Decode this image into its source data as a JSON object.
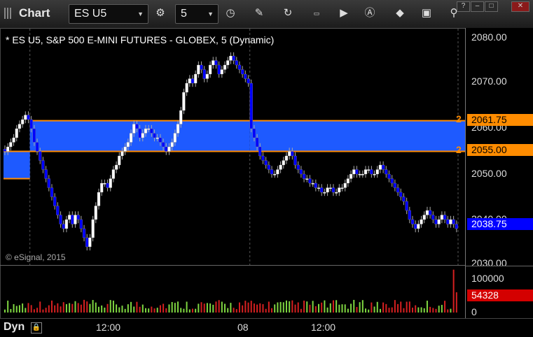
{
  "app": {
    "title": "Chart"
  },
  "toolbar": {
    "symbol": "ES U5",
    "interval": "5",
    "icons": [
      "settings-gear-icon",
      "clock-icon",
      "pencil-icon",
      "refresh-icon",
      "get-icon",
      "play-icon",
      "alert-icon",
      "eraser-icon",
      "comment-icon",
      "link-icon"
    ]
  },
  "window_controls": [
    "?",
    "–",
    "□",
    "✕"
  ],
  "chart_heading": "* ES U5, S&P 500 E-MINI FUTURES - GLOBEX, 5 (Dynamic)",
  "copyright": "© eSignal, 2015",
  "price_axis": {
    "ticks": [
      "2080.00",
      "2070.00",
      "2060.00",
      "2050.00",
      "2040.00",
      "2030.00"
    ],
    "tags": {
      "upper": "2061.75",
      "lower": "2055.00",
      "last": "2038.75"
    },
    "side_marker": "2"
  },
  "volume_axis": {
    "ticks": [
      "100000",
      "0"
    ],
    "last": "54328"
  },
  "time_axis": {
    "labels": [
      "12:00",
      "08",
      "12:00"
    ]
  },
  "bottom": {
    "mode": "Dyn"
  },
  "colors": {
    "up": "#ffffff",
    "down": "#0000ff",
    "zone": "#1e5aff",
    "zone_edge": "#ff8c00"
  },
  "chart_data": {
    "type": "candlestick",
    "ylim": [
      2030,
      2082
    ],
    "zones": [
      {
        "from_bar": 0,
        "to_bar": 9,
        "top": 2055.0,
        "bottom": 2049.0
      },
      {
        "from_bar": 9,
        "to_bar": 84,
        "top": 2061.75,
        "bottom": 2055.0
      },
      {
        "from_bar": 84,
        "to_bar": 160,
        "top": 2061.75,
        "bottom": 2055.0
      }
    ],
    "closes": [
      2055,
      2056,
      2057,
      2058,
      2060,
      2061,
      2062,
      2063,
      2062,
      2060,
      2057,
      2055,
      2053,
      2051,
      2049,
      2047,
      2045,
      2043,
      2041,
      2039,
      2038,
      2040,
      2041,
      2039,
      2041,
      2040,
      2038,
      2036,
      2034,
      2036,
      2040,
      2043,
      2046,
      2048,
      2048,
      2047,
      2049,
      2051,
      2052,
      2054,
      2055,
      2056,
      2057,
      2059,
      2061,
      2060,
      2058,
      2059,
      2060,
      2060,
      2059,
      2058,
      2058,
      2057,
      2056,
      2055,
      2056,
      2057,
      2059,
      2061,
      2064,
      2068,
      2070,
      2071,
      2070,
      2072,
      2074,
      2073,
      2071,
      2072,
      2074,
      2075,
      2074,
      2072,
      2073,
      2074,
      2075,
      2076,
      2075,
      2074,
      2073,
      2072,
      2071,
      2070,
      2060,
      2058,
      2056,
      2054,
      2053,
      2052,
      2051,
      2050,
      2050,
      2051,
      2052,
      2053,
      2054,
      2055,
      2054,
      2052,
      2051,
      2050,
      2049,
      2049,
      2048,
      2048,
      2047,
      2047,
      2046,
      2046,
      2047,
      2047,
      2046,
      2046,
      2047,
      2047,
      2048,
      2049,
      2050,
      2051,
      2050,
      2050,
      2050,
      2051,
      2051,
      2050,
      2050,
      2051,
      2052,
      2051,
      2050,
      2049,
      2048,
      2047,
      2046,
      2045,
      2044,
      2042,
      2040,
      2039,
      2038,
      2039,
      2040,
      2041,
      2042,
      2041,
      2040,
      2039,
      2040,
      2041,
      2040,
      2039,
      2040,
      2039,
      2038
    ],
    "volume_max": 120000,
    "volume_last": 54328
  }
}
